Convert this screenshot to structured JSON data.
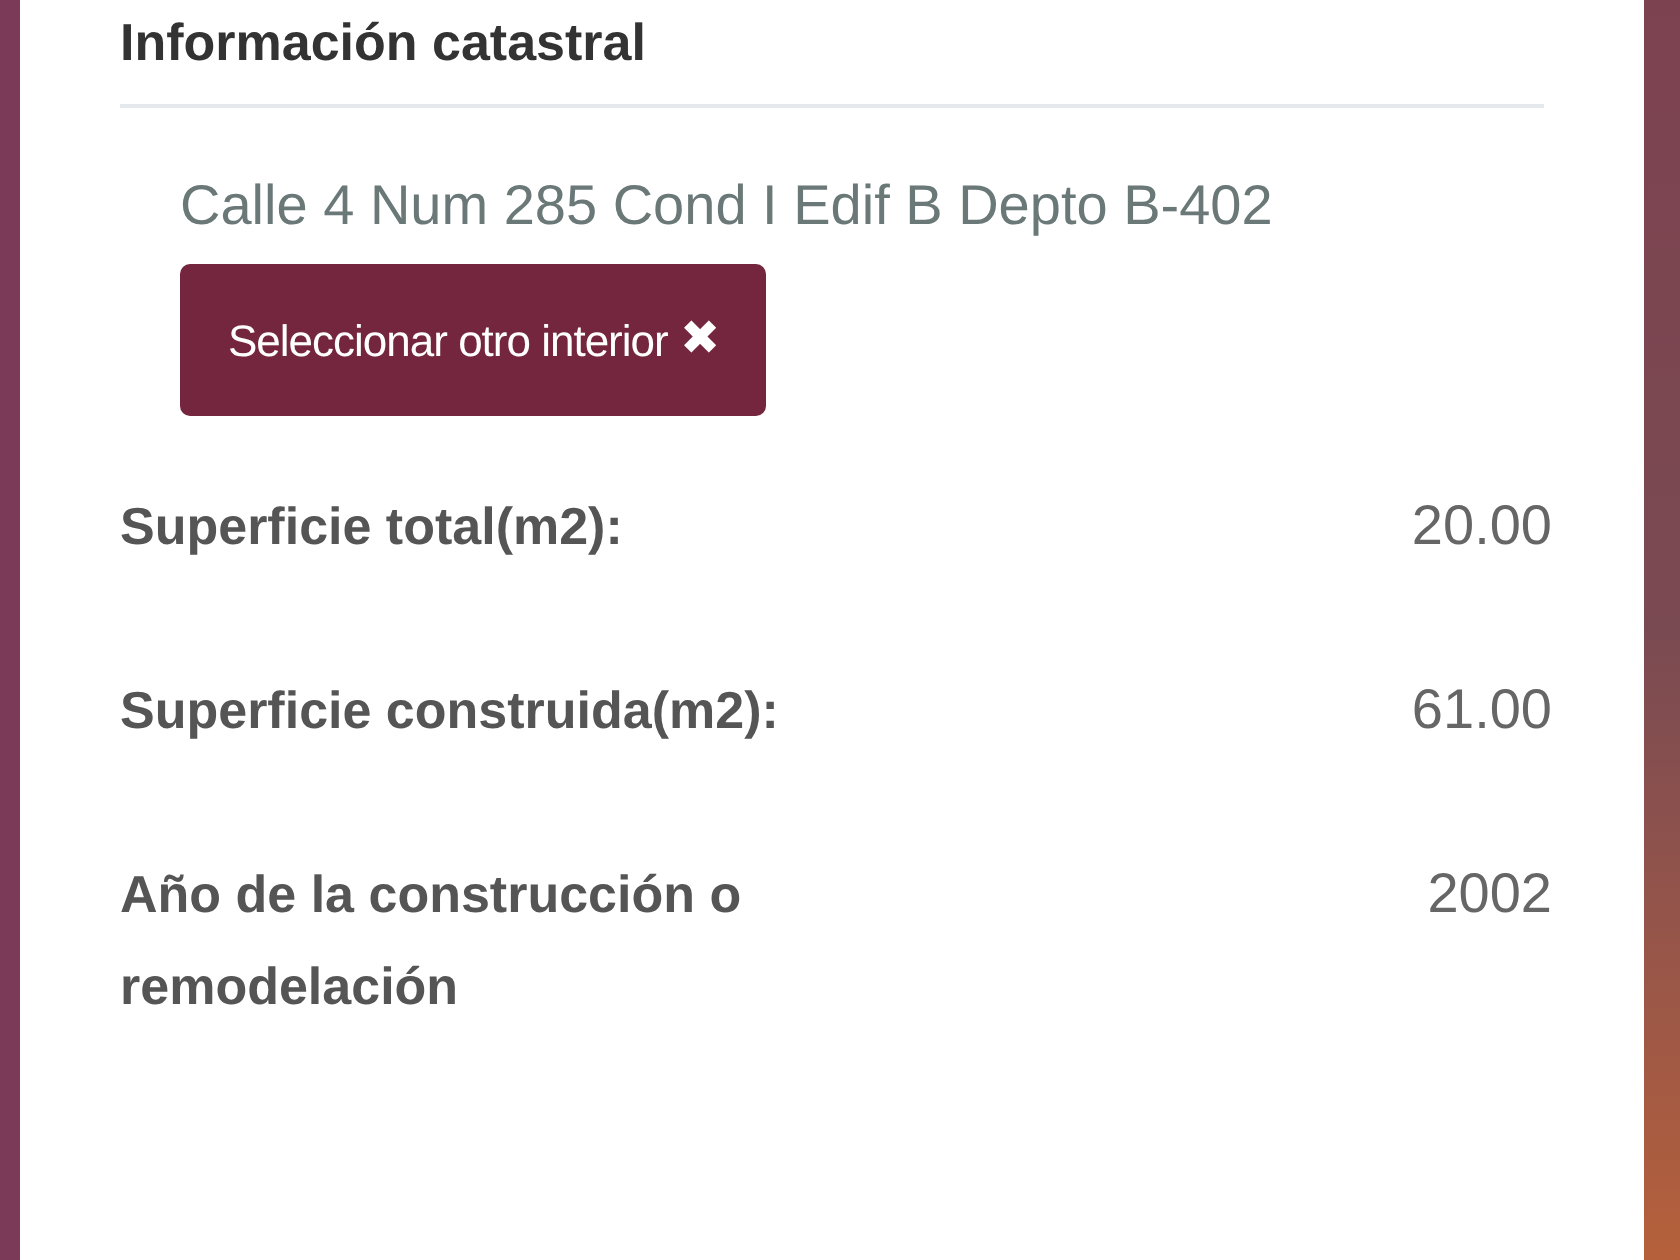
{
  "panel": {
    "title": "Información catastral",
    "address": "Calle 4 Num 285 Cond I Edif B Depto B-402",
    "change_button": {
      "label": "Seleccionar otro interior",
      "icon": "✖"
    },
    "fields": [
      {
        "label": "Superficie total(m2):",
        "value": "20.00"
      },
      {
        "label": "Superficie construida(m2):",
        "value": "61.00"
      },
      {
        "label": "Año de la construcción o remodelación",
        "value": "2002"
      }
    ]
  }
}
